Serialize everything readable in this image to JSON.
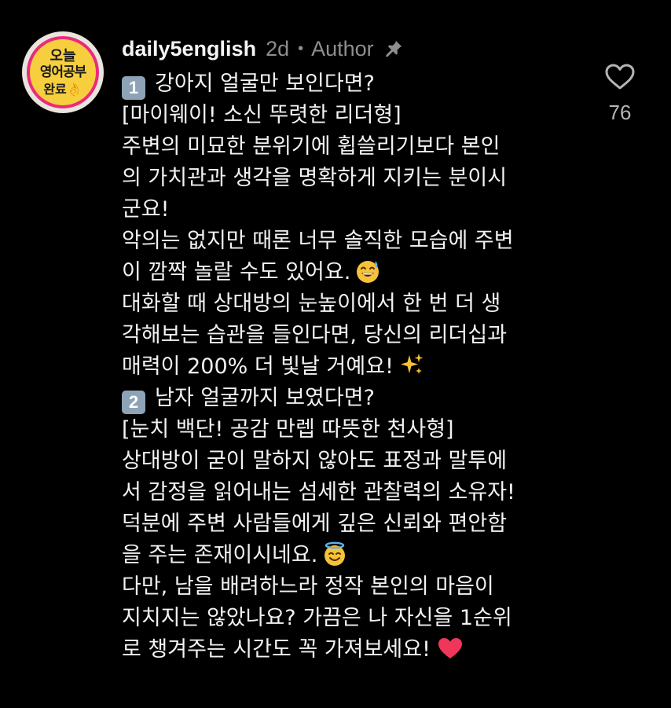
{
  "comment": {
    "avatar": {
      "lines": [
        "오늘",
        "영어공부",
        "완료👌"
      ],
      "colors": {
        "fill": "#f7cf3e",
        "ring": "#ea2b7d",
        "outer": "#e9e4dc"
      }
    },
    "username": "daily5english",
    "timestamp": "2d",
    "separator": "•",
    "role_badge": "Author",
    "pin_icon": "pin-icon",
    "likes": {
      "icon": "heart-outline-icon",
      "count": "76"
    },
    "body_lines": [
      {
        "keycap": "1",
        "text": "강아지 얼굴만 보인다면?"
      },
      {
        "text": "[마이웨이! 소신 뚜렷한 리더형]"
      },
      {
        "text": "주변의 미묘한 분위기에 휩쓸리기보다 본인"
      },
      {
        "text": "의 가치관과 생각을 명확하게 지키는 분이시"
      },
      {
        "text": "군요!"
      },
      {
        "text": "악의는 없지만 때론 너무 솔직한 모습에 주변"
      },
      {
        "text": "이 깜짝 놀랄 수도 있어요.",
        "emoji": "sweat-smile-emoji"
      },
      {
        "text": "대화할 때 상대방의 눈높이에서 한 번 더 생"
      },
      {
        "text": "각해보는 습관을 들인다면, 당신의 리더십과"
      },
      {
        "text": "매력이 200% 더 빛날 거예요!",
        "emoji": "sparkles-emoji"
      },
      {
        "keycap": "2",
        "text": "남자 얼굴까지 보였다면?"
      },
      {
        "text": "[눈치 백단! 공감 만렙 따뜻한 천사형]"
      },
      {
        "text": "상대방이 굳이 말하지 않아도 표정과 말투에"
      },
      {
        "text": "서 감정을 읽어내는 섬세한 관찰력의 소유자!"
      },
      {
        "text": "덕분에 주변 사람들에게 깊은 신뢰와 편안함"
      },
      {
        "text": "을 주는 존재이시네요.",
        "emoji": "halo-smile-emoji"
      },
      {
        "text": "다만, 남을 배려하느라 정작 본인의 마음이"
      },
      {
        "text": "지치지는 않았나요? 가끔은 나 자신을 1순위"
      },
      {
        "text": "로 챙겨주는 시간도 꼭 가져보세요!",
        "emoji": "red-heart-emoji"
      }
    ],
    "colors": {
      "background": "#000000",
      "text": "#f2f2f2",
      "muted": "#8e8e8e",
      "keycap": "#8ea3b5",
      "heart": "#f0365a"
    }
  }
}
